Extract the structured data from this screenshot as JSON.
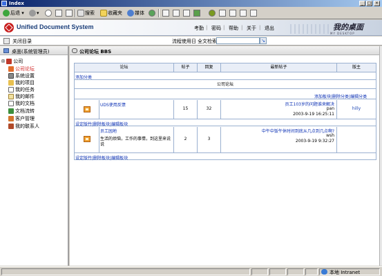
{
  "window": {
    "title": "Index"
  },
  "toolbar": {
    "back": "后退",
    "search": "搜索",
    "favorites": "收藏夹",
    "media": "媒体"
  },
  "header": {
    "system_name": "Unified Document System",
    "links": [
      "考勤",
      "密码",
      "帮助",
      "关于",
      "退出"
    ],
    "desk_title": "我的桌面",
    "desk_subtitle": "MY DESKTOP"
  },
  "bar2": {
    "close_tree": "关闭目录",
    "flow_usage": "流程使用日",
    "full_text_search": "全文检索",
    "search_value": ""
  },
  "sidebar": {
    "title": "桌面(系统管理员)",
    "items": [
      {
        "label": "公司",
        "icon": "company-icon",
        "selected": false
      },
      {
        "label": "公司论坛",
        "icon": "forum-icon",
        "selected": true
      },
      {
        "label": "系统设置",
        "icon": "settings-icon",
        "selected": false
      },
      {
        "label": "我的项目",
        "icon": "project-icon",
        "selected": false
      },
      {
        "label": "我的任务",
        "icon": "task-icon",
        "selected": false
      },
      {
        "label": "我的邮件",
        "icon": "mail-icon",
        "selected": false
      },
      {
        "label": "我的文档",
        "icon": "document-icon",
        "selected": false
      },
      {
        "label": "文档流转",
        "icon": "flow-icon",
        "selected": false
      },
      {
        "label": "客户管理",
        "icon": "customer-icon",
        "selected": false
      },
      {
        "label": "我的联系人",
        "icon": "contact-icon",
        "selected": false
      }
    ]
  },
  "main": {
    "title": "公司论坛 BBS",
    "columns": [
      "论坛",
      "帖子",
      "回复",
      "最新帖子",
      "版主"
    ],
    "add_category": "添加分类",
    "category_name": "公司论坛",
    "category_actions": [
      "添加板块",
      "删除分类",
      "编辑分类"
    ],
    "board_actions": [
      "设定版竹",
      "删除板块",
      "编辑板块"
    ],
    "boards": [
      {
        "name": "UDS使用反馈",
        "description": "",
        "posts": "15",
        "replies": "32",
        "latest_title": "员工103岁的问题谁来解决",
        "latest_author": "pan",
        "latest_time": "2003-9-19 16:25:11",
        "moderator": "hilly"
      },
      {
        "name": "员工园地",
        "description": "生活的烦恼，工作的事情，到这里来说说",
        "posts": "2",
        "replies": "3",
        "latest_title": "中午中饭午休时间到底从几点到几点啊?",
        "latest_author": "wsh",
        "latest_time": "2003-9-19 9:32:27",
        "moderator": ""
      }
    ]
  },
  "statusbar": {
    "zone": "本地 Intranet"
  }
}
